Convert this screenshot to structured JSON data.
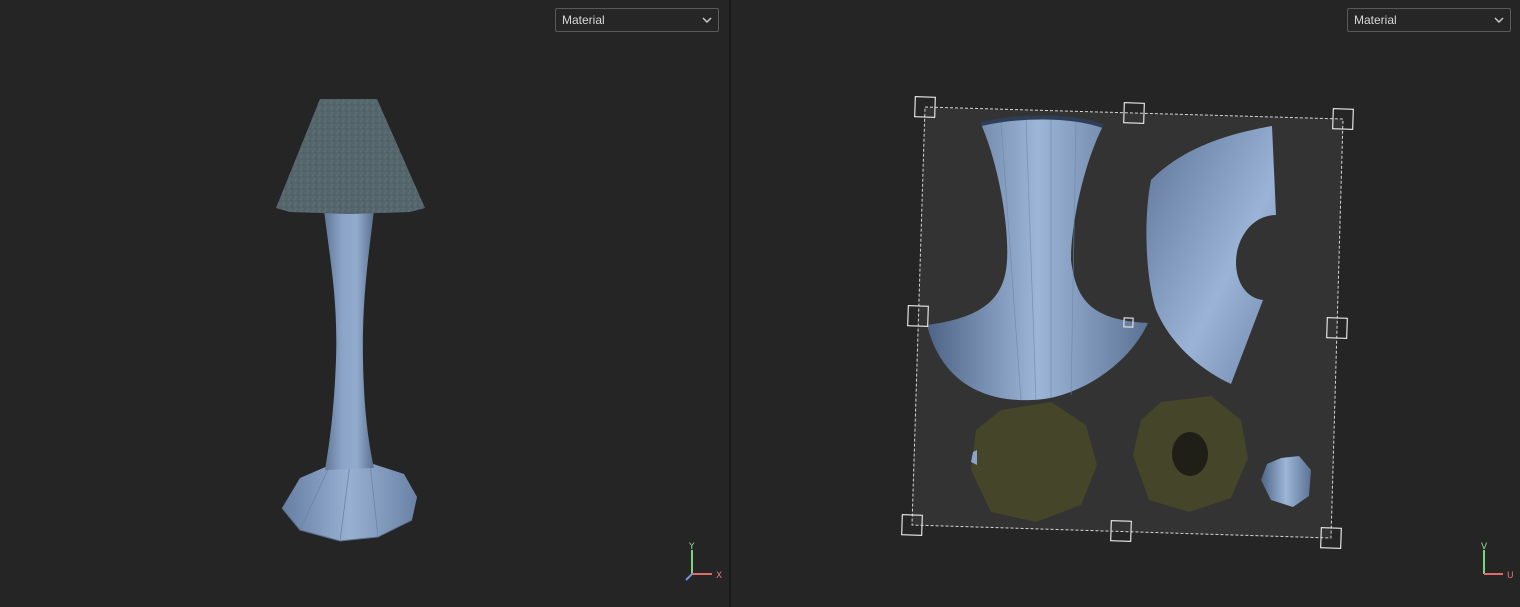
{
  "viewport_3d": {
    "shading_mode": "Material",
    "axes": {
      "y": "Y",
      "x": "X"
    }
  },
  "viewport_uv": {
    "shading_mode": "Material",
    "axes": {
      "v": "V",
      "u": "U"
    }
  },
  "colors": {
    "background": "#252525",
    "mesh": "#7c95b8",
    "shade": "#5c7193",
    "fabric": "#53636a",
    "uv_bounds_fill": "#333333",
    "uv_island_olive": "#45452a",
    "axis_x": "#e06a6a",
    "axis_y": "#7fd27f"
  },
  "icons": {
    "dropdown": "chevron-down-icon",
    "gizmo": "axis-gizmo-icon"
  }
}
